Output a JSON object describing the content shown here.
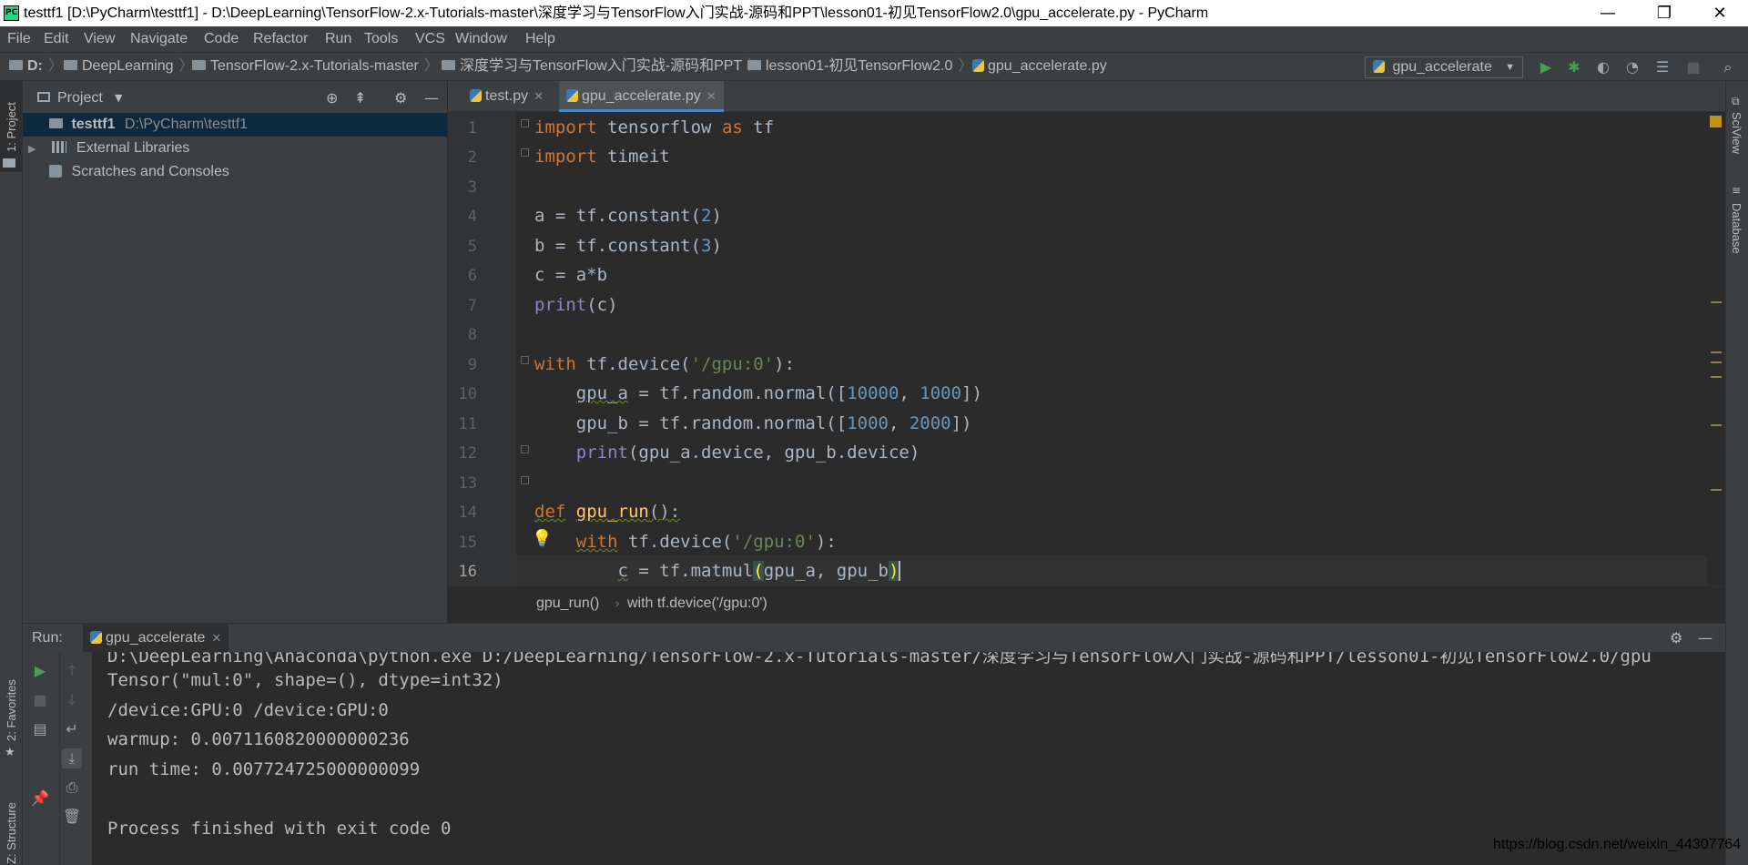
{
  "window": {
    "title": "testtf1 [D:\\PyCharm\\testtf1] - D:\\DeepLearning\\TensorFlow-2.x-Tutorials-master\\深度学习与TensorFlow入门实战-源码和PPT\\lesson01-初见TensorFlow2.0\\gpu_accelerate.py - PyCharm",
    "minimize": "—",
    "restore": "❐",
    "close": "✕"
  },
  "menu": [
    "File",
    "Edit",
    "View",
    "Navigate",
    "Code",
    "Refactor",
    "Run",
    "Tools",
    "VCS",
    "Window",
    "Help"
  ],
  "breadcrumbs": [
    "D:",
    "DeepLearning",
    "TensorFlow-2.x-Tutorials-master",
    "深度学习与TensorFlow入门实战-源码和PPT",
    "lesson01-初见TensorFlow2.0",
    "gpu_accelerate.py"
  ],
  "run_config": "gpu_accelerate",
  "toolbar_icons": [
    "run-icon",
    "debug-icon",
    "coverage-icon",
    "profile-icon",
    "build-icon",
    "stop-icon",
    "search-icon"
  ],
  "left_strip": {
    "project": "1: Project",
    "favorites": "2: Favorites",
    "structure": "Z: Structure"
  },
  "right_strip": {
    "sciview": "SciView",
    "database": "Database"
  },
  "project_panel": {
    "title": "Project",
    "tree": [
      {
        "name": "testtf1",
        "path": "D:\\PyCharm\\testtf1"
      },
      {
        "name": "External Libraries"
      },
      {
        "name": "Scratches and Consoles"
      }
    ]
  },
  "editor": {
    "tabs": [
      {
        "label": "test.py",
        "active": false
      },
      {
        "label": "gpu_accelerate.py",
        "active": true
      }
    ],
    "line_numbers": [
      "1",
      "2",
      "3",
      "4",
      "5",
      "6",
      "7",
      "8",
      "9",
      "10",
      "11",
      "12",
      "13",
      "14",
      "15",
      "16"
    ],
    "breadcrumb": [
      "gpu_run()",
      "with tf.device('/gpu:0')"
    ]
  },
  "run_panel": {
    "label": "Run:",
    "tab": "gpu_accelerate",
    "output": [
      "D:\\DeepLearning\\Anaconda\\python.exe D:/DeepLearning/TensorFlow-2.x-Tutorials-master/深度学习与TensorFlow入门实战-源码和PPT/lesson01-初见TensorFlow2.0/gpu",
      "Tensor(\"mul:0\", shape=(), dtype=int32)",
      "/device:GPU:0 /device:GPU:0",
      "warmup: 0.0071160820000000236",
      "run time: 0.007724725000000099",
      "",
      "Process finished with exit code 0"
    ]
  },
  "watermark": "https://blog.csdn.net/weixin_44307764",
  "colors": {
    "bg": "#2b2b2b",
    "panel": "#3c3f41",
    "keyword": "#cc7832",
    "number": "#6897bb",
    "string": "#6a8759",
    "builtin": "#8888c6",
    "run_green": "#499c54"
  }
}
